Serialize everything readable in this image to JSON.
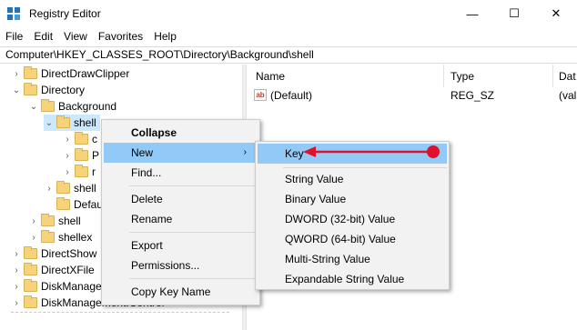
{
  "window": {
    "title": "Registry Editor",
    "minimize": "—",
    "maximize": "☐",
    "close": "✕"
  },
  "menu": [
    "File",
    "Edit",
    "View",
    "Favorites",
    "Help"
  ],
  "address": "Computer\\HKEY_CLASSES_ROOT\\Directory\\Background\\shell",
  "tree": {
    "items": [
      {
        "label": "DirectDrawClipper"
      },
      {
        "label": "Directory"
      },
      {
        "label": "Background"
      },
      {
        "label": "shell"
      },
      {
        "label": "c"
      },
      {
        "label": "P"
      },
      {
        "label": "r"
      },
      {
        "label": "shell"
      },
      {
        "label": "DefaultI"
      },
      {
        "label": "shell"
      },
      {
        "label": "shellex"
      },
      {
        "label": "DirectShow"
      },
      {
        "label": "DirectXFile"
      },
      {
        "label": "DiskManage"
      },
      {
        "label": "DiskManagement.Control"
      }
    ]
  },
  "values": {
    "columns": [
      "Name",
      "Type",
      "Dat"
    ],
    "rows": [
      {
        "name": "(Default)",
        "type": "REG_SZ",
        "data": "(val"
      }
    ]
  },
  "context_menu": {
    "items": [
      "Collapse",
      "New",
      "Find...",
      "Delete",
      "Rename",
      "Export",
      "Permissions...",
      "Copy Key Name"
    ]
  },
  "submenu": {
    "items": [
      "Key",
      "String Value",
      "Binary Value",
      "DWORD (32-bit) Value",
      "QWORD (64-bit) Value",
      "Multi-String Value",
      "Expandable String Value"
    ]
  },
  "colors": {
    "highlight": "#91c9f7",
    "annotation": "#e0112b",
    "selection": "#cce8ff"
  }
}
